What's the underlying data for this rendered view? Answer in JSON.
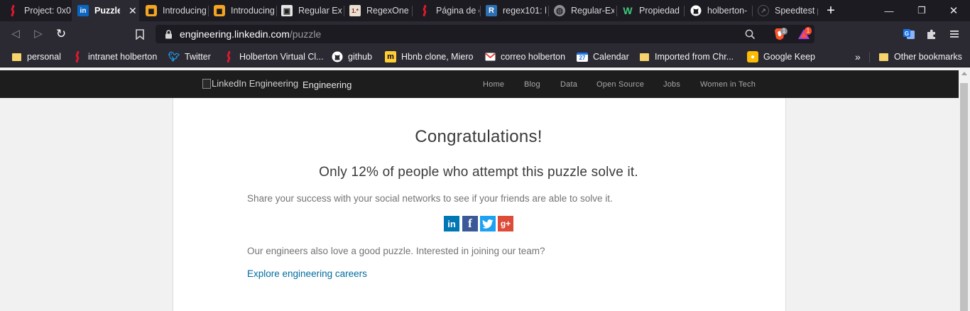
{
  "tabs": [
    {
      "title": "Project: 0x0",
      "icon": "holberton-icon"
    },
    {
      "title": "Puzzle | L",
      "icon": "linkedin-icon"
    },
    {
      "title": "Introducing",
      "icon": "introducing-icon"
    },
    {
      "title": "Introducing",
      "icon": "introducing-icon"
    },
    {
      "title": "Regular Exp",
      "icon": "regex-book-icon"
    },
    {
      "title": "RegexOne",
      "icon": "regexone-icon"
    },
    {
      "title": "Página de c",
      "icon": "holberton-icon"
    },
    {
      "title": "regex101: b",
      "icon": "regex101-icon"
    },
    {
      "title": "Regular-Exp",
      "icon": "globe-icon"
    },
    {
      "title": "Propiedad",
      "icon": "w-icon"
    },
    {
      "title": "holberton-",
      "icon": "github-icon"
    },
    {
      "title": "Speedtest p",
      "icon": "speedtest-icon"
    }
  ],
  "address": {
    "host": "engineering.linkedin.com",
    "path": "/puzzle"
  },
  "extensions": {
    "brave_badge": "1",
    "rewards_badge": "1"
  },
  "bookmarks": [
    {
      "label": "personal",
      "icon": "folder-icon"
    },
    {
      "label": "intranet holberton",
      "icon": "holberton-icon"
    },
    {
      "label": "Twitter",
      "icon": "twitter-icon"
    },
    {
      "label": "Holberton Virtual Cl...",
      "icon": "holberton-icon"
    },
    {
      "label": "github",
      "icon": "github-icon"
    },
    {
      "label": "Hbnb clone, Miero",
      "icon": "miro-icon"
    },
    {
      "label": "correo holberton",
      "icon": "gmail-icon"
    },
    {
      "label": "Calendar",
      "icon": "calendar-icon"
    },
    {
      "label": "Imported from Chr...",
      "icon": "folder-icon"
    },
    {
      "label": "Google Keep",
      "icon": "keep-icon"
    }
  ],
  "bookmarks_overflow": "»",
  "other_bookmarks": "Other bookmarks",
  "calendar_day": "27",
  "site": {
    "logo_alt": "LinkedIn Engineering",
    "logo_text": "Engineering",
    "nav": [
      "Home",
      "Blog",
      "Data",
      "Open Source",
      "Jobs",
      "Women in Tech"
    ]
  },
  "content": {
    "title": "Congratulations!",
    "subtitle": "Only 12% of people who attempt this puzzle solve it.",
    "share_text": "Share your success with your social networks to see if your friends are able to solve it.",
    "social": [
      {
        "glyph": "in",
        "icon": "linkedin-share-icon",
        "color": "#0077b5"
      },
      {
        "glyph": "f",
        "icon": "facebook-share-icon",
        "color": "#3b5998"
      },
      {
        "glyph": "",
        "icon": "twitter-share-icon",
        "color": "#1da1f2"
      },
      {
        "glyph": "g+",
        "icon": "googleplus-share-icon",
        "color": "#dd4b39"
      }
    ],
    "engineers_text": "Our engineers also love a good puzzle. Interested in joining our team?",
    "careers_link": "Explore engineering careers"
  },
  "colors": {
    "chrome_dark": "#1c1b22",
    "toolbar": "#2b2a33",
    "link": "#006c9e",
    "header_bg": "#1d1d1d"
  }
}
